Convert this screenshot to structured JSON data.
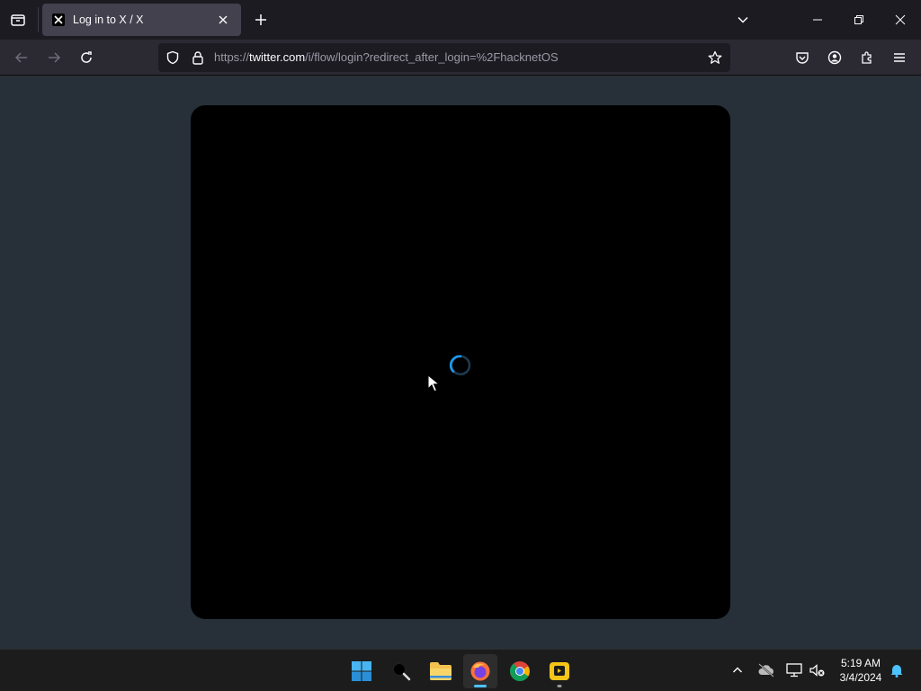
{
  "browser": {
    "tab": {
      "title": "Log in to X / X",
      "favicon": "x-logo-icon"
    },
    "url": {
      "scheme": "https://",
      "host": "twitter.com",
      "path": "/i/flow/login?redirect_after_login=%2FhacknetOS"
    }
  },
  "page": {
    "state": "loading",
    "spinner_color": "#1d9bf0",
    "modal_color": "#000000",
    "backdrop_color": "#273038"
  },
  "taskbar": {
    "apps": [
      {
        "name": "start-icon",
        "active": false
      },
      {
        "name": "search-icon",
        "active": false
      },
      {
        "name": "file-explorer-icon",
        "active": false
      },
      {
        "name": "firefox-icon",
        "active": true
      },
      {
        "name": "chrome-icon",
        "active": false
      },
      {
        "name": "app-icon",
        "active": false
      }
    ],
    "clock": {
      "time": "5:19 AM",
      "date": "3/4/2024"
    }
  }
}
